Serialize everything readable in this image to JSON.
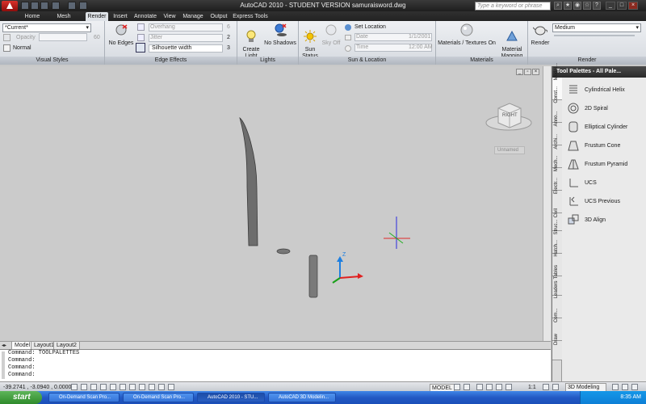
{
  "titlebar": {
    "title": "AutoCAD 2010 - STUDENT VERSION    samuraisword.dwg",
    "search_placeholder": "Type a keyword or phrase"
  },
  "ribbon_tabs": [
    {
      "label": "Home"
    },
    {
      "label": "Mesh Modeling"
    },
    {
      "label": "Render"
    },
    {
      "label": "Insert"
    },
    {
      "label": "Annotate"
    },
    {
      "label": "View"
    },
    {
      "label": "Manage"
    },
    {
      "label": "Output"
    },
    {
      "label": "Express Tools"
    }
  ],
  "active_tab": "Render",
  "visual_styles": {
    "style": "*Current*",
    "opacity_label": "Opacity",
    "opacity_value": "60",
    "normal_label": "Normal",
    "title": "Visual Styles"
  },
  "edge_effects": {
    "no_edges": "No Edges",
    "overhang": "Overhang",
    "overhang_value": "6",
    "jitter": "Jitter",
    "jitter_value": "2",
    "silhouette": "Silhouette width",
    "silhouette_value": "3",
    "title": "Edge Effects"
  },
  "lights": {
    "create": "Create\nLight",
    "no_shadows": "No Shadows",
    "title": "Lights"
  },
  "sun": {
    "status": "Sun\nStatus",
    "sky": "Sky Off",
    "set_location": "Set Location",
    "date_label": "Date",
    "date_value": "1/1/2001",
    "time_label": "Time",
    "time_value": "12:00 AM",
    "title": "Sun & Location"
  },
  "materials": {
    "toggle": "Materials / Textures On",
    "mapping": "Material\nMapping",
    "title": "Materials"
  },
  "render": {
    "button": "Render",
    "quality": "Medium",
    "title": "Render"
  },
  "viewport": {
    "viewcube_face": "RIGHT",
    "ucs_name": "Unnamed"
  },
  "layout_tabs": [
    {
      "label": "Model"
    },
    {
      "label": "Layout1"
    },
    {
      "label": "Layout2"
    }
  ],
  "command_lines": [
    "Command: TOOLPALETTES",
    "Command:",
    "Command:",
    "Command:"
  ],
  "status": {
    "coords": "-39.2741 , -3.0940 , 0.0000",
    "model": "MODEL",
    "scale": "1:1",
    "workspace": "3D Modeling"
  },
  "palette": {
    "title": "Tool Palettes - All Pale...",
    "tabs": [
      "Model...",
      "Const...",
      "Anno...",
      "Archi...",
      "Mech...",
      "Electr...",
      "Civil",
      "Struc...",
      "Hatch...",
      "Tables",
      "Leaders",
      "Com...",
      "Draw"
    ],
    "items": [
      {
        "label": "Cylindrical Helix"
      },
      {
        "label": "2D Spiral"
      },
      {
        "label": "Elliptical Cylinder"
      },
      {
        "label": "Frustum Cone"
      },
      {
        "label": "Frustum Pyramid"
      },
      {
        "label": "UCS"
      },
      {
        "label": "UCS Previous"
      },
      {
        "label": "3D Align"
      }
    ]
  },
  "taskbar": {
    "start": "start",
    "tasks": [
      {
        "label": "On-Demand Scan Pro..."
      },
      {
        "label": "On-Demand Scan Pro..."
      },
      {
        "label": "AutoCAD 2010 - STU..."
      },
      {
        "label": "AutoCAD 3D Modelin..."
      }
    ],
    "clock": "8:35 AM"
  }
}
